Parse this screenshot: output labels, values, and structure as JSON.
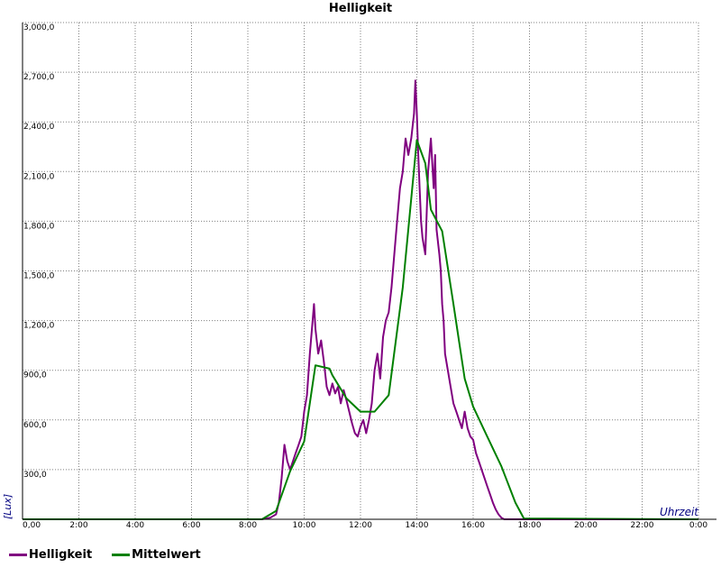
{
  "chart_data": {
    "type": "line",
    "title": "Helligkeit",
    "xlabel": "Uhrzeit",
    "ylabel": "[Lux]",
    "xlim": [
      0,
      24
    ],
    "ylim": [
      0,
      3000
    ],
    "grid": true,
    "legend_position": "bottom-left",
    "x_ticks": [
      "0,00",
      "2:00",
      "4:00",
      "6:00",
      "8:00",
      "10:00",
      "12:00",
      "14:00",
      "16:00",
      "18:00",
      "20:00",
      "22:00",
      "0:00"
    ],
    "y_ticks": [
      "300,0",
      "600,0",
      "900,0",
      "1,200,0",
      "1,500,0",
      "1,800,0",
      "2,100,0",
      "2,400,0",
      "2,700,0",
      "3,000,0"
    ],
    "series": [
      {
        "name": "Helligkeit",
        "color": "#800080",
        "x": [
          0,
          8.5,
          8.8,
          9.0,
          9.1,
          9.2,
          9.3,
          9.4,
          9.5,
          9.6,
          9.7,
          9.8,
          9.9,
          10.0,
          10.1,
          10.2,
          10.3,
          10.35,
          10.4,
          10.5,
          10.6,
          10.7,
          10.8,
          10.9,
          11.0,
          11.1,
          11.2,
          11.3,
          11.4,
          11.5,
          11.6,
          11.7,
          11.8,
          11.9,
          12.0,
          12.1,
          12.2,
          12.3,
          12.4,
          12.5,
          12.6,
          12.7,
          12.8,
          12.9,
          13.0,
          13.1,
          13.2,
          13.3,
          13.4,
          13.5,
          13.6,
          13.7,
          13.8,
          13.9,
          13.95,
          14.0,
          14.05,
          14.1,
          14.15,
          14.2,
          14.3,
          14.4,
          14.5,
          14.6,
          14.65,
          14.7,
          14.8,
          14.85,
          14.9,
          14.95,
          15.0,
          15.1,
          15.2,
          15.3,
          15.4,
          15.5,
          15.6,
          15.7,
          15.8,
          15.9,
          16.0,
          16.1,
          16.2,
          16.3,
          16.4,
          16.5,
          16.6,
          16.7,
          16.8,
          16.9,
          17.0,
          17.1,
          17.2,
          17.3,
          17.4,
          17.6,
          17.8,
          18.0,
          24
        ],
        "y": [
          0,
          0,
          10,
          30,
          100,
          250,
          450,
          350,
          300,
          350,
          400,
          450,
          500,
          650,
          750,
          1000,
          1200,
          1300,
          1150,
          1000,
          1080,
          950,
          800,
          750,
          820,
          760,
          800,
          700,
          780,
          720,
          650,
          580,
          520,
          500,
          560,
          600,
          520,
          600,
          700,
          900,
          1000,
          850,
          1100,
          1200,
          1250,
          1400,
          1600,
          1800,
          2000,
          2100,
          2300,
          2200,
          2300,
          2450,
          2650,
          2450,
          2200,
          2000,
          1800,
          1700,
          1600,
          2100,
          2300,
          2000,
          2200,
          1750,
          1600,
          1500,
          1300,
          1200,
          1000,
          900,
          800,
          700,
          650,
          600,
          550,
          650,
          550,
          500,
          480,
          400,
          350,
          300,
          250,
          200,
          150,
          100,
          60,
          30,
          10,
          0,
          0,
          0,
          0,
          0,
          0,
          0,
          0
        ]
      },
      {
        "name": "Mittelwert",
        "color": "#008000",
        "x": [
          0,
          8.5,
          9.0,
          9.5,
          10.0,
          10.4,
          10.9,
          11.0,
          11.5,
          12.0,
          12.5,
          13.0,
          13.5,
          14.0,
          14.3,
          14.5,
          14.9,
          15.3,
          15.7,
          16.0,
          16.5,
          17.0,
          17.5,
          17.8,
          24
        ],
        "y": [
          0,
          0,
          50,
          290,
          470,
          930,
          910,
          870,
          730,
          650,
          650,
          750,
          1400,
          2290,
          2150,
          1870,
          1740,
          1300,
          850,
          680,
          500,
          320,
          100,
          5,
          0
        ]
      }
    ]
  }
}
